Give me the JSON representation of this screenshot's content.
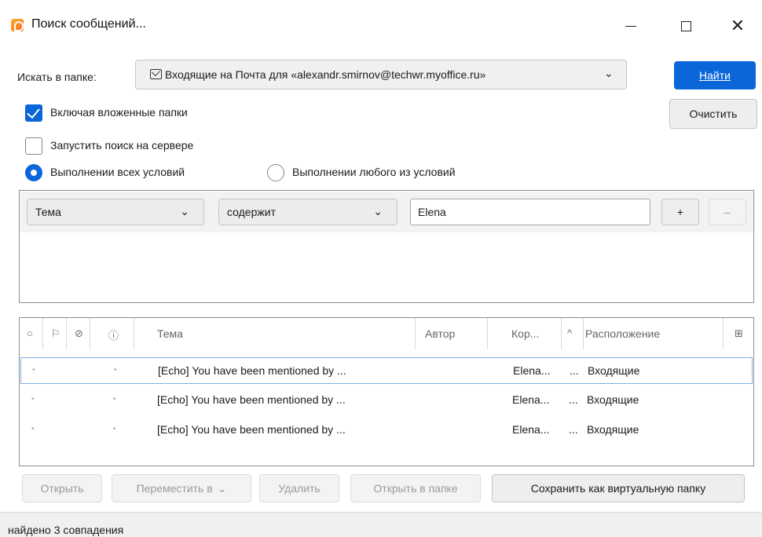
{
  "window": {
    "title": "Поиск сообщений..."
  },
  "search": {
    "folder_label": "Искать в папке:",
    "folder_value": "Входящие на Почта для «alexandr.smirnov@techwr.myoffice.ru»",
    "find_label": "Найти",
    "clear_label": "Очистить",
    "include_subfolders": {
      "label": "Включая вложенные папки",
      "checked": true
    },
    "server_search": {
      "label": "Запустить поиск на сервере",
      "checked": false
    },
    "match_all": {
      "label": "Выполнении всех условий",
      "selected": true
    },
    "match_any": {
      "label": "Выполнении любого из условий",
      "selected": false
    }
  },
  "criteria": {
    "field": "Тема",
    "operator": "содержит",
    "value": "Elena",
    "add_label": "+",
    "remove_label": "–"
  },
  "results": {
    "columns": {
      "subject": "Тема",
      "author": "Автор",
      "recipient": "Кор...",
      "location": "Расположение"
    },
    "rows": [
      {
        "subject": "[Echo] You have been mentioned by ...",
        "recipient": "Elena...",
        "ellipsis": "...",
        "location": "Входящие"
      },
      {
        "subject": "[Echo] You have been mentioned by ...",
        "recipient": "Elena...",
        "ellipsis": "...",
        "location": "Входящие"
      },
      {
        "subject": "[Echo] You have been mentioned by ...",
        "recipient": "Elena...",
        "ellipsis": "...",
        "location": "Входящие"
      }
    ]
  },
  "actions": {
    "open": "Открыть",
    "move": "Переместить в",
    "delete": "Удалить",
    "open_in_folder": "Открыть в папке",
    "save_virtual": "Сохранить как виртуальную папку"
  },
  "status": {
    "text": "найдено 3 совпадения"
  },
  "colors": {
    "accent": "#0a66d9"
  }
}
